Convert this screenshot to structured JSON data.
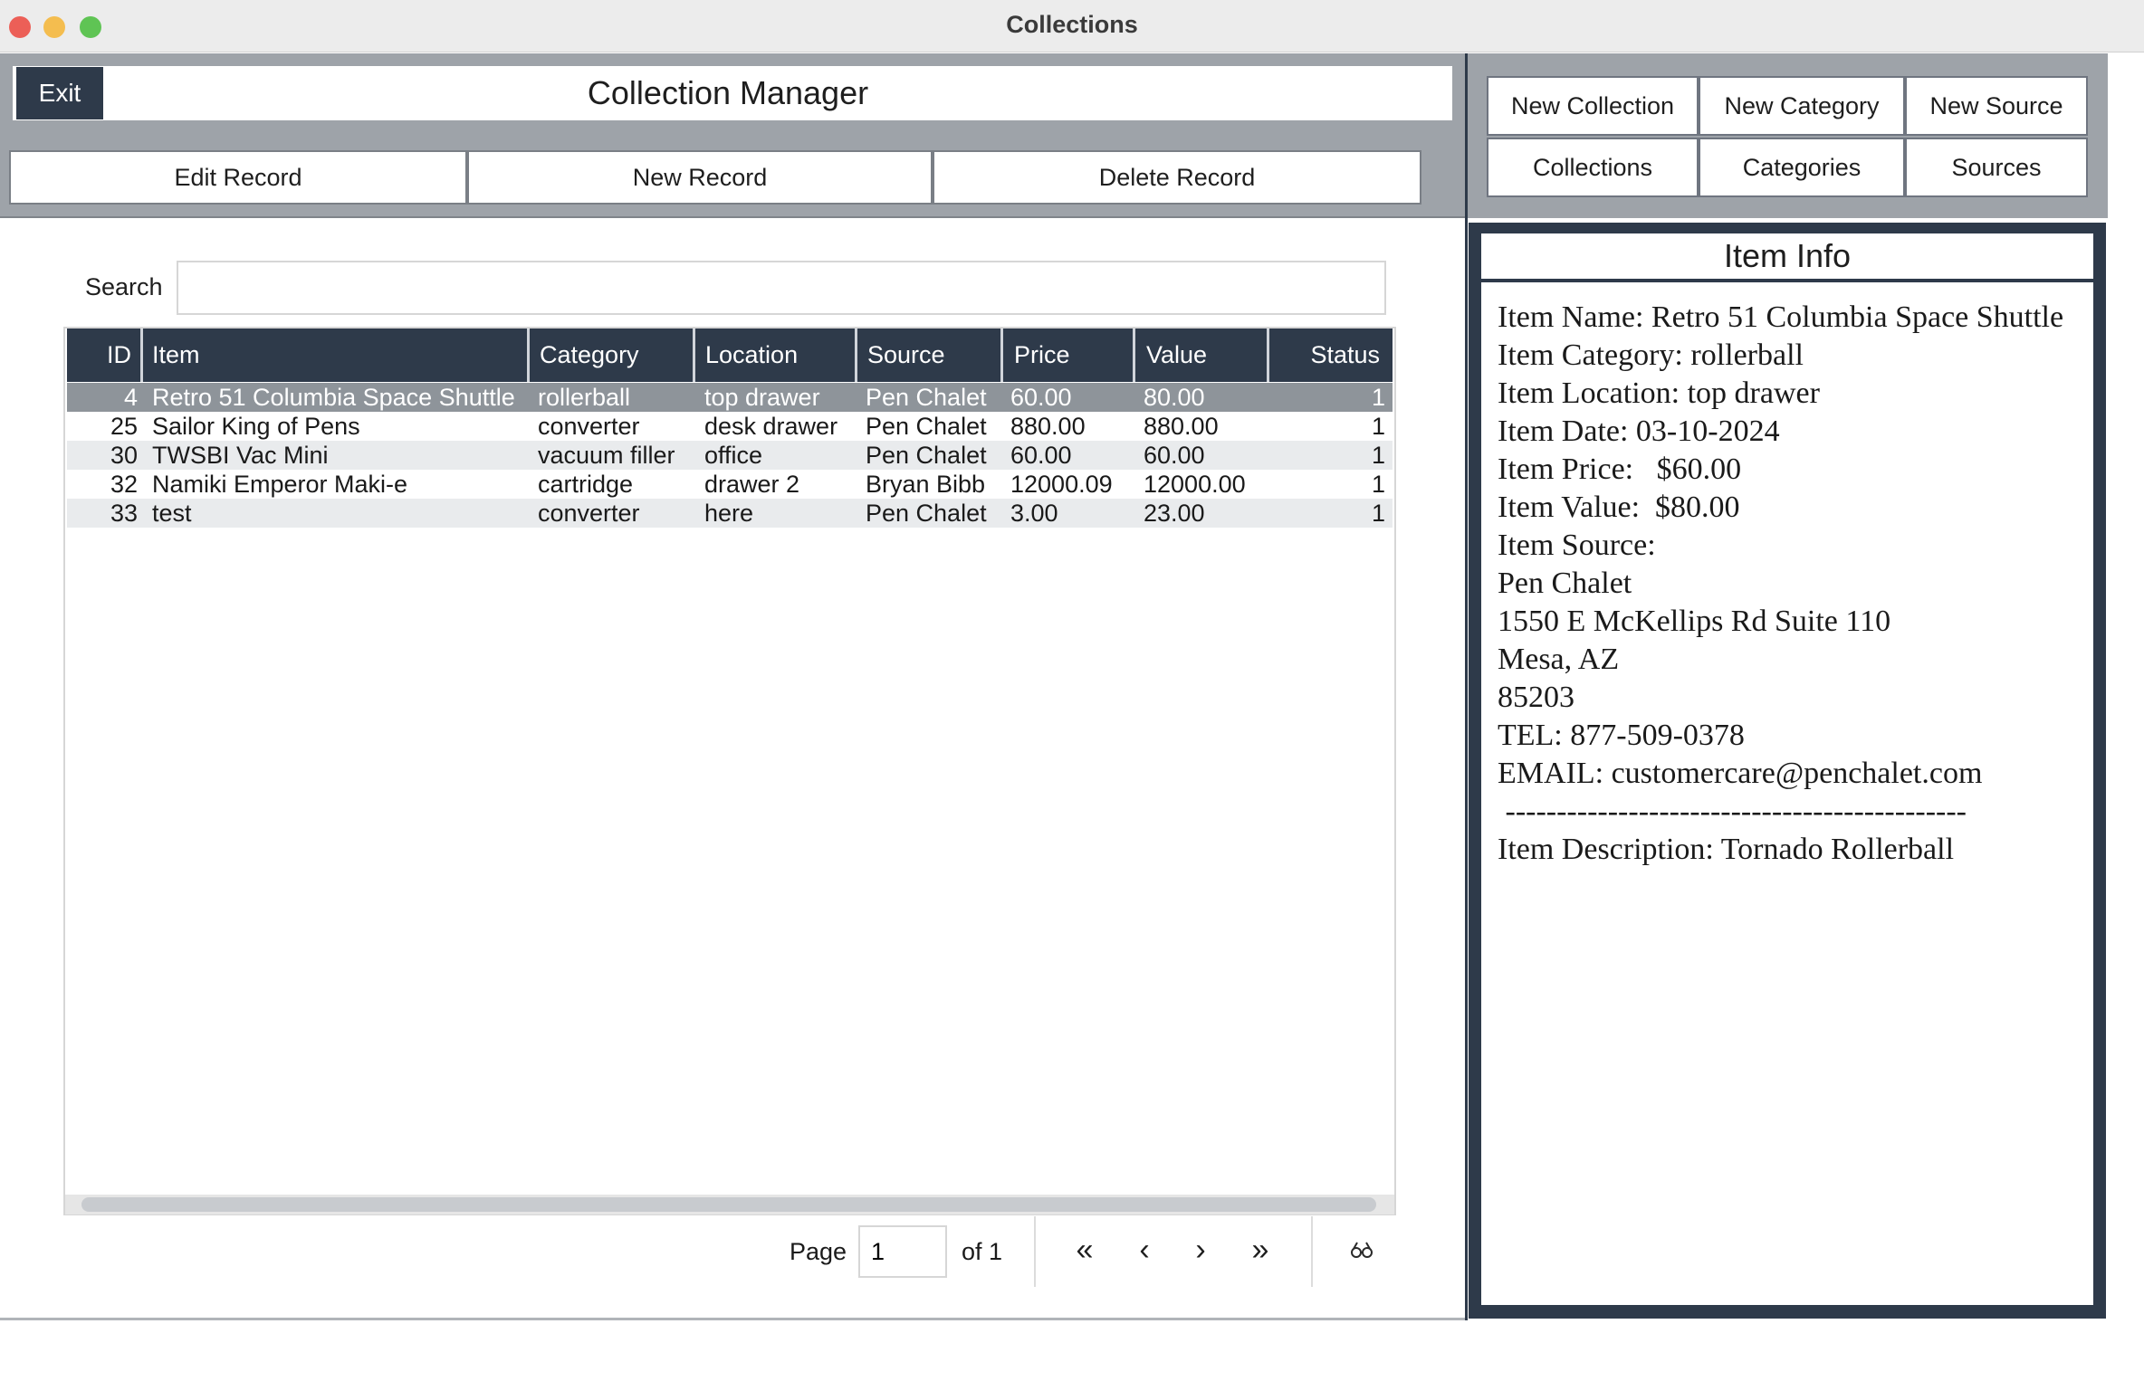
{
  "window": {
    "title": "Collections"
  },
  "header": {
    "exit_label": "Exit",
    "app_title": "Collection Manager"
  },
  "record_buttons": {
    "edit": "Edit Record",
    "new": "New Record",
    "delete": "Delete Record"
  },
  "source_buttons": {
    "new_collection": "New Collection",
    "new_category": "New Category",
    "new_source": "New Source",
    "collections": "Collections",
    "categories": "Categories",
    "sources": "Sources"
  },
  "search": {
    "label": "Search",
    "value": ""
  },
  "table": {
    "columns": [
      "ID",
      "Item",
      "Category",
      "Location",
      "Source",
      "Price",
      "Value",
      "Status"
    ],
    "rows": [
      {
        "id": "4",
        "item": "Retro 51 Columbia Space Shuttle",
        "category": "rollerball",
        "location": "top drawer",
        "source": "Pen Chalet",
        "price": "60.00",
        "value": "80.00",
        "status": "1"
      },
      {
        "id": "25",
        "item": "Sailor King of Pens",
        "category": "converter",
        "location": "desk drawer",
        "source": "Pen Chalet",
        "price": "880.00",
        "value": "880.00",
        "status": "1"
      },
      {
        "id": "30",
        "item": "TWSBI Vac Mini",
        "category": "vacuum filler",
        "location": "office",
        "source": "Pen Chalet",
        "price": "60.00",
        "value": "60.00",
        "status": "1"
      },
      {
        "id": "32",
        "item": "Namiki Emperor Maki-e",
        "category": "cartridge",
        "location": "drawer 2",
        "source": "Bryan Bibb",
        "price": "12000.09",
        "value": "12000.00",
        "status": "1"
      },
      {
        "id": "33",
        "item": "test",
        "category": "converter",
        "location": "here",
        "source": "Pen Chalet",
        "price": "3.00",
        "value": "23.00",
        "status": "1"
      }
    ],
    "selected_row": 0
  },
  "pagination": {
    "page_label": "Page",
    "page_value": "1",
    "of_label": "of 1",
    "first": "«",
    "prev": "‹",
    "next": "›",
    "last": "»",
    "settings_icon": "glasses-icon"
  },
  "item_info": {
    "title": "Item Info",
    "lines": [
      "Item Name: Retro 51 Columbia Space Shuttle",
      "",
      "Item Category: rollerball",
      "Item Location: top drawer",
      "Item Date: 03-10-2024",
      "",
      "",
      "Item Price:   $60.00",
      "Item Value:  $80.00",
      "",
      "Item Source:",
      "Pen Chalet",
      "1550 E McKellips Rd Suite 110",
      "Mesa, AZ",
      "85203",
      "TEL: 877-509-0378",
      "EMAIL: customercare@penchalet.com",
      "",
      " ---------------------------------------------",
      "Item Description: Tornado Rollerball"
    ]
  }
}
